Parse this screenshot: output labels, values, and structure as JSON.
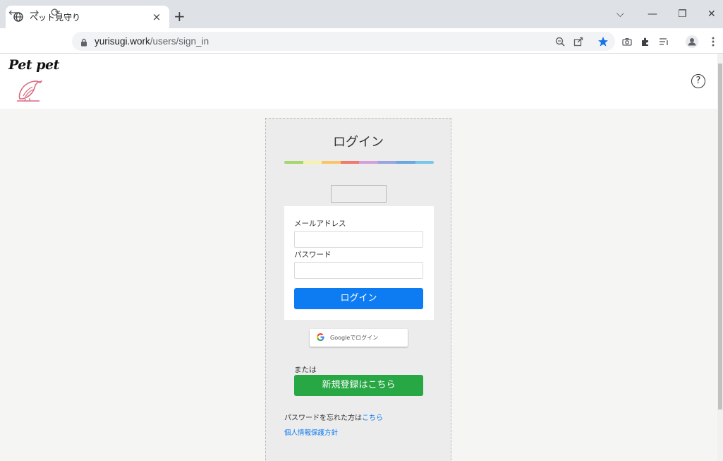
{
  "browser": {
    "tab_title": "ペット見守り",
    "tab_close": "×",
    "new_tab": "+",
    "url_host": "yurisugi.work",
    "url_path": "/users/sign_in",
    "window_controls": [
      "⌵",
      "—",
      "❐",
      "✕"
    ]
  },
  "site": {
    "logo_text": "Pet pet",
    "help_label": "?"
  },
  "login": {
    "title": "ログイン",
    "email_label": "メールアドレス",
    "password_label": "パスワード",
    "email_value": "",
    "password_value": "",
    "submit_label": "ログイン",
    "google_label": "Googleでログイン",
    "or_label": "または",
    "register_label": "新規登録はこちら",
    "forgot_prefix": "パスワードを忘れた方は",
    "forgot_link": "こちら",
    "privacy_link": "個人情報保護方針"
  },
  "colors": {
    "primary": "#0d7cf2",
    "success": "#28a745",
    "rainbow": [
      "#a5d66f",
      "#f6f2a8",
      "#f9c56a",
      "#ee7b6c",
      "#d3a0d8",
      "#9aa5e0",
      "#6aa7e0",
      "#7ac6ea"
    ],
    "bird": "#d9687f"
  }
}
